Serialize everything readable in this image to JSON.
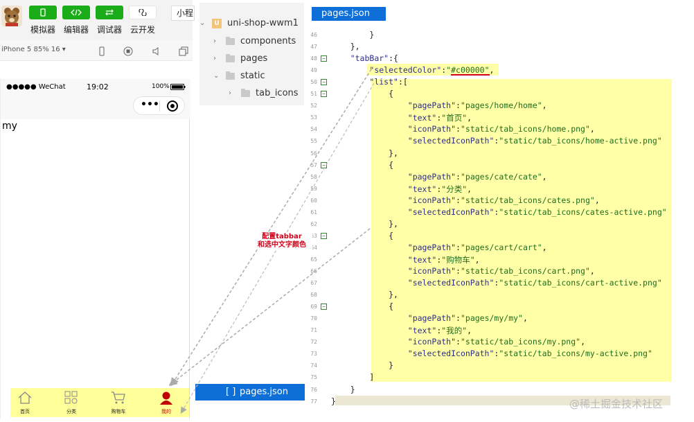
{
  "toolbar": {
    "tools": [
      {
        "label": "模拟器",
        "icon": "phone-icon"
      },
      {
        "label": "编辑器",
        "icon": "code-icon"
      },
      {
        "label": "调试器",
        "icon": "debug-icon"
      },
      {
        "label": "云开发",
        "icon": "cloud-icon"
      }
    ],
    "small_program": "小程"
  },
  "device": {
    "selector": "iPhone 5 85% 16 ▾"
  },
  "phone": {
    "status_carrier": "●●●●● WeChat",
    "status_time": "19:02",
    "status_battery": "100%",
    "capsule_dots": "•••",
    "page_text": "my",
    "tabs": [
      {
        "label": "首页",
        "icon": "home-icon"
      },
      {
        "label": "分类",
        "icon": "category-icon"
      },
      {
        "label": "购物车",
        "icon": "cart-icon"
      },
      {
        "label": "我的",
        "icon": "user-icon"
      }
    ]
  },
  "explorer": {
    "project": "uni-shop-wwm1",
    "items": [
      "components",
      "pages",
      "static",
      "tab_icons"
    ],
    "selected_file": "pages.json",
    "selected_brackets": "[ ]"
  },
  "editor": {
    "tab": "pages.json",
    "lines": [
      {
        "n": "46",
        "code": "        }"
      },
      {
        "n": "47",
        "code": "    },"
      },
      {
        "n": "48",
        "code": "    \"tabBar\":{"
      },
      {
        "n": "49",
        "code": "        \"selectedColor\":\"#c00000\","
      },
      {
        "n": "50",
        "code": "        \"list\":["
      },
      {
        "n": "51",
        "code": "            {"
      },
      {
        "n": "52",
        "code": "                \"pagePath\":\"pages/home/home\","
      },
      {
        "n": "53",
        "code": "                \"text\":\"首页\","
      },
      {
        "n": "54",
        "code": "                \"iconPath\":\"static/tab_icons/home.png\","
      },
      {
        "n": "55",
        "code": "                \"selectedIconPath\":\"static/tab_icons/home-active.png\""
      },
      {
        "n": "56",
        "code": "            },"
      },
      {
        "n": "57",
        "code": "            {"
      },
      {
        "n": "58",
        "code": "                \"pagePath\":\"pages/cate/cate\","
      },
      {
        "n": "59",
        "code": "                \"text\":\"分类\","
      },
      {
        "n": "60",
        "code": "                \"iconPath\":\"static/tab_icons/cates.png\","
      },
      {
        "n": "61",
        "code": "                \"selectedIconPath\":\"static/tab_icons/cates-active.png\""
      },
      {
        "n": "62",
        "code": "            },"
      },
      {
        "n": "63",
        "code": "            {"
      },
      {
        "n": "64",
        "code": "                \"pagePath\":\"pages/cart/cart\","
      },
      {
        "n": "65",
        "code": "                \"text\":\"购物车\","
      },
      {
        "n": "66",
        "code": "                \"iconPath\":\"static/tab_icons/cart.png\","
      },
      {
        "n": "67",
        "code": "                \"selectedIconPath\":\"static/tab_icons/cart-active.png\""
      },
      {
        "n": "68",
        "code": "            },"
      },
      {
        "n": "69",
        "code": "            {"
      },
      {
        "n": "70",
        "code": "                \"pagePath\":\"pages/my/my\","
      },
      {
        "n": "71",
        "code": "                \"text\":\"我的\","
      },
      {
        "n": "72",
        "code": "                \"iconPath\":\"static/tab_icons/my.png\","
      },
      {
        "n": "73",
        "code": "                \"selectedIconPath\":\"static/tab_icons/my-active.png\""
      },
      {
        "n": "74",
        "code": "            }"
      },
      {
        "n": "75",
        "code": "        ]"
      },
      {
        "n": "76",
        "code": "    }"
      },
      {
        "n": "77",
        "code": "}"
      }
    ]
  },
  "annotation": {
    "line1": "配置tabbar",
    "line2": "和选中文字颜色"
  },
  "watermark": "@稀土掘金技术社区",
  "colors": {
    "accent": "#0e6fd8",
    "selected": "#c00000",
    "wechat_green": "#1aad19",
    "highlight": "#ffffa8"
  }
}
